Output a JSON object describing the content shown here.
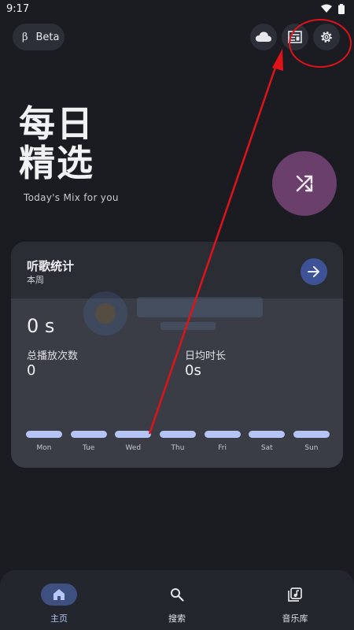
{
  "status_bar": {
    "time": "9:17",
    "icons": [
      "wifi-icon",
      "battery-icon"
    ]
  },
  "header": {
    "beta_symbol": "β",
    "beta_label": "Beta",
    "actions": [
      "cloud-icon",
      "news-icon",
      "gear-icon"
    ]
  },
  "hero": {
    "title_line1": "每日",
    "title_line2": "精选",
    "subtitle": "Today's Mix for you",
    "shuffle_icon": "shuffle-icon"
  },
  "stats": {
    "title": "听歌统计",
    "period": "本周",
    "total_time": "0 s",
    "plays_label": "总播放次数",
    "plays_value": "0",
    "daily_avg_label": "日均时长",
    "daily_avg_value": "0s",
    "days": [
      "Mon",
      "Tue",
      "Wed",
      "Thu",
      "Fri",
      "Sat",
      "Sun"
    ]
  },
  "nav": {
    "items": [
      {
        "label": "主页",
        "icon": "home-icon",
        "active": true
      },
      {
        "label": "搜索",
        "icon": "search-icon",
        "active": false
      },
      {
        "label": "音乐库",
        "icon": "library-icon",
        "active": false
      }
    ]
  },
  "colors": {
    "background": "#1a1c22",
    "card": "#3a3d45",
    "accent": "#3e5396",
    "shuffle": "#6b3f6b",
    "annotation": "#e0131a"
  }
}
